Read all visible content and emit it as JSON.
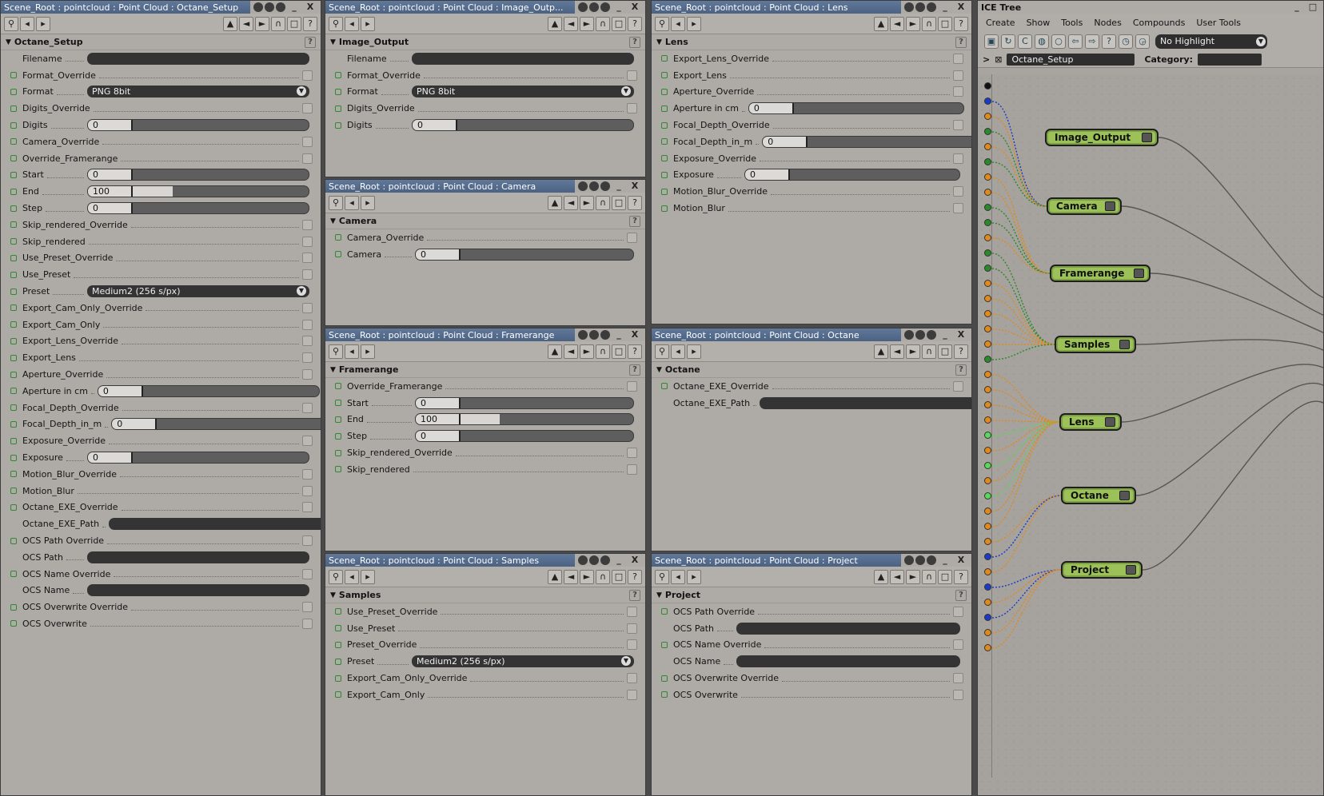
{
  "windows": {
    "octane_setup": {
      "title": "Scene_Root : pointcloud : Point Cloud : Octane_Setup",
      "section": "Octane_Setup",
      "rows": [
        {
          "type": "field",
          "label": "Filename",
          "cb": false,
          "value": ""
        },
        {
          "type": "check",
          "label": "Format_Override"
        },
        {
          "type": "dropdown",
          "label": "Format",
          "value": "PNG 8bit"
        },
        {
          "type": "check",
          "label": "Digits_Override"
        },
        {
          "type": "slider",
          "label": "Digits",
          "value": "0",
          "fill": 0
        },
        {
          "type": "check",
          "label": "Camera_Override"
        },
        {
          "type": "check",
          "label": "Override_Framerange"
        },
        {
          "type": "slider",
          "label": "Start",
          "value": "0",
          "fill": 0
        },
        {
          "type": "slider",
          "label": "End",
          "value": "100",
          "fill": 0.5
        },
        {
          "type": "slider",
          "label": "Step",
          "value": "0",
          "fill": 0
        },
        {
          "type": "check",
          "label": "Skip_rendered_Override"
        },
        {
          "type": "check",
          "label": "Skip_rendered"
        },
        {
          "type": "check",
          "label": "Use_Preset_Override"
        },
        {
          "type": "check",
          "label": "Use_Preset"
        },
        {
          "type": "dropdown",
          "label": "Preset",
          "value": "Medium2 (256 s/px)"
        },
        {
          "type": "check",
          "label": "Export_Cam_Only_Override"
        },
        {
          "type": "check",
          "label": "Export_Cam_Only"
        },
        {
          "type": "check",
          "label": "Export_Lens_Override"
        },
        {
          "type": "check",
          "label": "Export_Lens"
        },
        {
          "type": "check",
          "label": "Aperture_Override"
        },
        {
          "type": "slider",
          "label": "Aperture in cm",
          "value": "0",
          "fill": 0
        },
        {
          "type": "check",
          "label": "Focal_Depth_Override"
        },
        {
          "type": "slider",
          "label": "Focal_Depth_in_m",
          "value": "0",
          "fill": 0
        },
        {
          "type": "check",
          "label": "Exposure_Override"
        },
        {
          "type": "slider",
          "label": "Exposure",
          "value": "0",
          "fill": 0
        },
        {
          "type": "check",
          "label": "Motion_Blur_Override"
        },
        {
          "type": "check",
          "label": "Motion_Blur"
        },
        {
          "type": "check",
          "label": "Octane_EXE_Override"
        },
        {
          "type": "field",
          "label": "Octane_EXE_Path",
          "cb": false,
          "value": ""
        },
        {
          "type": "check",
          "label": "OCS Path Override"
        },
        {
          "type": "field",
          "label": "OCS Path",
          "cb": false,
          "value": ""
        },
        {
          "type": "check",
          "label": "OCS Name Override"
        },
        {
          "type": "field",
          "label": "OCS Name",
          "cb": false,
          "value": ""
        },
        {
          "type": "check",
          "label": "OCS Overwrite Override"
        },
        {
          "type": "check",
          "label": "OCS Overwrite"
        }
      ]
    },
    "image_output": {
      "title": "Scene_Root : pointcloud : Point Cloud : Image_Outp...",
      "section": "Image_Output",
      "rows": [
        {
          "type": "field",
          "label": "Filename",
          "cb": false,
          "value": ""
        },
        {
          "type": "check",
          "label": "Format_Override"
        },
        {
          "type": "dropdown",
          "label": "Format",
          "value": "PNG 8bit"
        },
        {
          "type": "check",
          "label": "Digits_Override"
        },
        {
          "type": "slider",
          "label": "Digits",
          "value": "0",
          "fill": 0
        }
      ]
    },
    "lens": {
      "title": "Scene_Root : pointcloud : Point Cloud : Lens",
      "section": "Lens",
      "rows": [
        {
          "type": "check",
          "label": "Export_Lens_Override"
        },
        {
          "type": "check",
          "label": "Export_Lens"
        },
        {
          "type": "check",
          "label": "Aperture_Override"
        },
        {
          "type": "slider",
          "label": "Aperture in cm",
          "value": "0",
          "fill": 0
        },
        {
          "type": "check",
          "label": "Focal_Depth_Override"
        },
        {
          "type": "slider",
          "label": "Focal_Depth_in_m",
          "value": "0",
          "fill": 0
        },
        {
          "type": "check",
          "label": "Exposure_Override"
        },
        {
          "type": "slider",
          "label": "Exposure",
          "value": "0",
          "fill": 0
        },
        {
          "type": "check",
          "label": "Motion_Blur_Override"
        },
        {
          "type": "check",
          "label": "Motion_Blur"
        }
      ]
    },
    "camera": {
      "title": "Scene_Root : pointcloud : Point Cloud : Camera",
      "section": "Camera",
      "rows": [
        {
          "type": "check",
          "label": "Camera_Override"
        },
        {
          "type": "slider",
          "label": "Camera",
          "value": "0",
          "fill": 0
        }
      ]
    },
    "framerange": {
      "title": "Scene_Root : pointcloud : Point Cloud : Framerange",
      "section": "Framerange",
      "rows": [
        {
          "type": "check",
          "label": "Override_Framerange"
        },
        {
          "type": "slider",
          "label": "Start",
          "value": "0",
          "fill": 0
        },
        {
          "type": "slider",
          "label": "End",
          "value": "100",
          "fill": 0.5
        },
        {
          "type": "slider",
          "label": "Step",
          "value": "0",
          "fill": 0
        },
        {
          "type": "check",
          "label": "Skip_rendered_Override"
        },
        {
          "type": "check",
          "label": "Skip_rendered"
        }
      ]
    },
    "octane": {
      "title": "Scene_Root : pointcloud : Point Cloud : Octane",
      "section": "Octane",
      "rows": [
        {
          "type": "check",
          "label": "Octane_EXE_Override"
        },
        {
          "type": "field",
          "label": "Octane_EXE_Path",
          "cb": false,
          "value": ""
        }
      ]
    },
    "samples": {
      "title": "Scene_Root : pointcloud : Point Cloud : Samples",
      "section": "Samples",
      "rows": [
        {
          "type": "check",
          "label": "Use_Preset_Override"
        },
        {
          "type": "check",
          "label": "Use_Preset"
        },
        {
          "type": "check",
          "label": "Preset_Override"
        },
        {
          "type": "dropdown",
          "label": "Preset",
          "value": "Medium2 (256 s/px)"
        },
        {
          "type": "check",
          "label": "Export_Cam_Only_Override"
        },
        {
          "type": "check",
          "label": "Export_Cam_Only"
        }
      ]
    },
    "project": {
      "title": "Scene_Root : pointcloud : Point Cloud : Project",
      "section": "Project",
      "rows": [
        {
          "type": "check",
          "label": "OCS Path Override"
        },
        {
          "type": "field",
          "label": "OCS Path",
          "cb": false,
          "value": ""
        },
        {
          "type": "check",
          "label": "OCS Name Override"
        },
        {
          "type": "field",
          "label": "OCS Name",
          "cb": false,
          "value": ""
        },
        {
          "type": "check",
          "label": "OCS Overwrite Override"
        },
        {
          "type": "check",
          "label": "OCS Overwrite"
        }
      ]
    }
  },
  "ice_tree": {
    "title": "ICE Tree",
    "menu": [
      "Create",
      "Show",
      "Tools",
      "Nodes",
      "Compounds",
      "User Tools"
    ],
    "highlight": "No Highlight",
    "compound": "Octane_Setup",
    "category_label": "Category:",
    "nodes": [
      "Image_Output",
      "Camera",
      "Framerange",
      "Samples",
      "Lens",
      "Octane",
      "Project"
    ]
  },
  "colors": {
    "title_bar": "#56708f",
    "panel": "#aeaaa5",
    "field": "#343434",
    "node": "#9bc158"
  }
}
